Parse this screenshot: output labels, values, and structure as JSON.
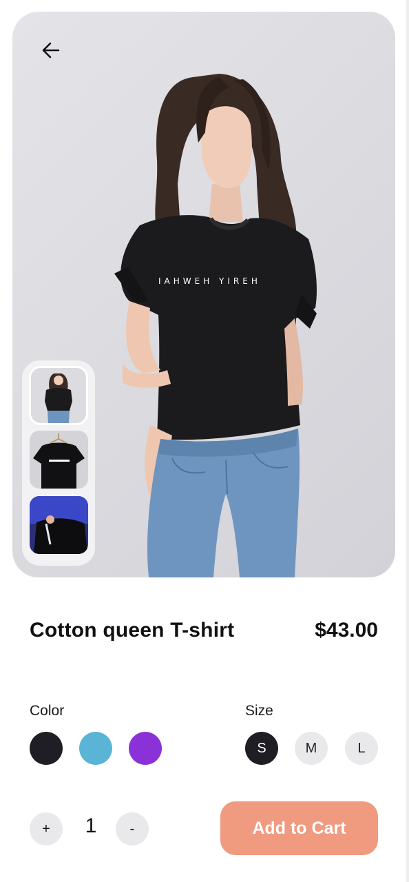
{
  "product": {
    "name": "Cotton queen T-shirt",
    "price": "$43.00",
    "shirt_print": "IAHWEH YIREH"
  },
  "icons": {
    "back": "arrow-left-icon"
  },
  "thumbnails": [
    {
      "name": "model-front-thumbnail",
      "selected": true
    },
    {
      "name": "shirt-on-hanger-thumbnail",
      "selected": false
    },
    {
      "name": "shirt-blue-light-thumbnail",
      "selected": false
    }
  ],
  "color_section": {
    "label": "Color",
    "options": [
      {
        "name": "black",
        "hex": "#1e1e24"
      },
      {
        "name": "sky-blue",
        "hex": "#5ab4d6"
      },
      {
        "name": "purple",
        "hex": "#8a32d8"
      }
    ]
  },
  "size_section": {
    "label": "Size",
    "options": [
      "S",
      "M",
      "L"
    ],
    "selected": "S"
  },
  "quantity": {
    "increment_label": "+",
    "value": "1",
    "decrement_label": "-"
  },
  "cart": {
    "button_label": "Add to Cart",
    "button_color": "#f09a80"
  }
}
